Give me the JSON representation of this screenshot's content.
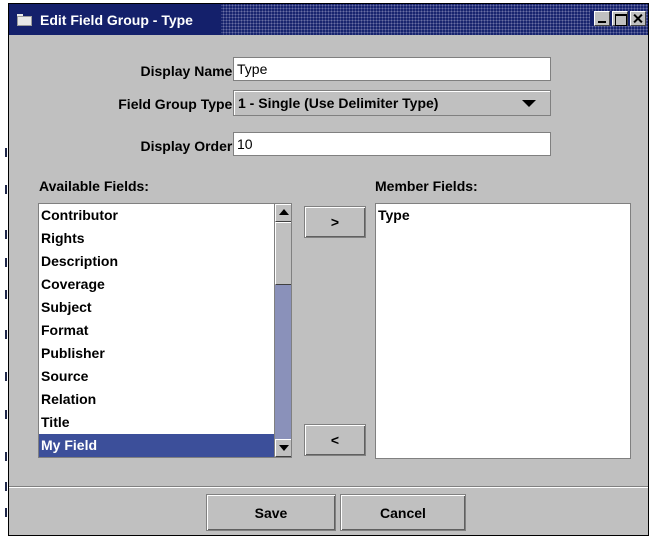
{
  "window": {
    "title": "Edit Field Group - Type",
    "icon": "folder-icon",
    "controls": [
      "minimize-icon",
      "maximize-icon",
      "close-icon"
    ]
  },
  "form": {
    "display_name_label": "Display Name:",
    "display_name_value": "Type",
    "field_group_type_label": "Field Group Type:",
    "field_group_type_value": "1 - Single (Use Delimiter Type)",
    "display_order_label": "Display Order:",
    "display_order_value": "10"
  },
  "available": {
    "label": "Available Fields:",
    "items": [
      "Contributor",
      "Rights",
      "Description",
      "Coverage",
      "Subject",
      "Format",
      "Publisher",
      "Source",
      "Relation",
      "Title",
      "My Field"
    ],
    "selected": "My Field"
  },
  "member": {
    "label": "Member Fields:",
    "items": [
      "Type"
    ]
  },
  "transfer": {
    "add_label": ">",
    "remove_label": "<"
  },
  "actions": {
    "save_label": "Save",
    "cancel_label": "Cancel"
  },
  "colors": {
    "titlebar": "#14206b",
    "selection": "#3c4f9a",
    "dialog_bg": "#c0c0c0"
  }
}
